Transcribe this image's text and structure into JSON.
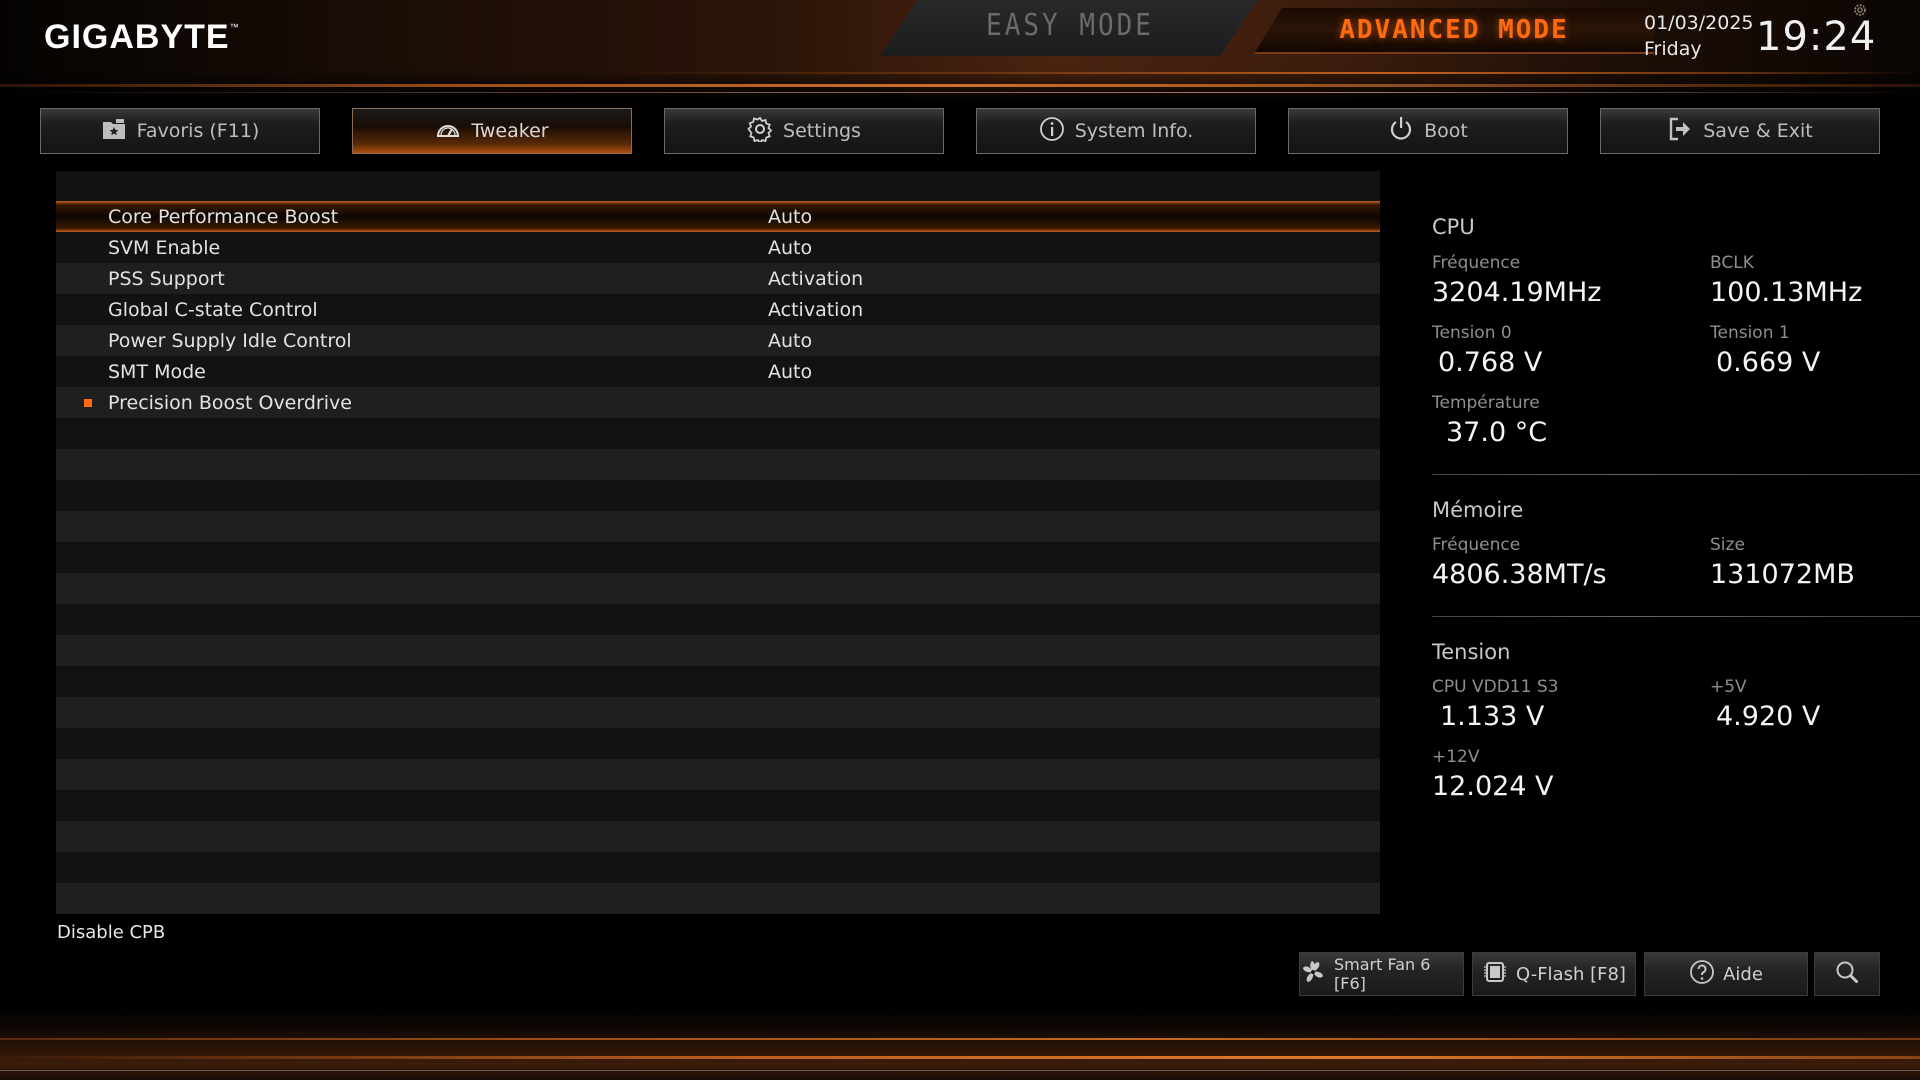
{
  "brand": {
    "logo": "GIGABYTE",
    "trademark": "™"
  },
  "modes": {
    "easy": "EASY MODE",
    "advanced": "ADVANCED MODE",
    "active": "advanced"
  },
  "datetime": {
    "date": "01/03/2025",
    "weekday": "Friday",
    "time": "19:24"
  },
  "tabs": [
    {
      "label": "Favoris (F11)",
      "icon": "favorites-folder-star-icon",
      "active": false
    },
    {
      "label": "Tweaker",
      "icon": "speedometer-icon",
      "active": true
    },
    {
      "label": "Settings",
      "icon": "gear-icon",
      "active": false
    },
    {
      "label": "System Info.",
      "icon": "info-icon",
      "active": false
    },
    {
      "label": "Boot",
      "icon": "power-icon",
      "active": false
    },
    {
      "label": "Save & Exit",
      "icon": "exit-icon",
      "active": false
    }
  ],
  "settings": [
    {
      "label": "Core Performance Boost",
      "value": "Auto",
      "selected": true,
      "submenu": false
    },
    {
      "label": "SVM Enable",
      "value": "Auto",
      "selected": false,
      "submenu": false
    },
    {
      "label": "PSS Support",
      "value": "Activation",
      "selected": false,
      "submenu": false
    },
    {
      "label": "Global C-state Control",
      "value": "Activation",
      "selected": false,
      "submenu": false
    },
    {
      "label": "Power Supply Idle Control",
      "value": "Auto",
      "selected": false,
      "submenu": false
    },
    {
      "label": "SMT Mode",
      "value": "Auto",
      "selected": false,
      "submenu": false
    },
    {
      "label": "Precision Boost Overdrive",
      "value": "",
      "selected": false,
      "submenu": true
    }
  ],
  "help_text": "Disable CPB",
  "info": {
    "cpu": {
      "title": "CPU",
      "freq_label": "Fréquence",
      "freq_value": "3204.19MHz",
      "bclk_label": "BCLK",
      "bclk_value": "100.13MHz",
      "v0_label": "Tension 0",
      "v0_value": "0.768 V",
      "v1_label": "Tension 1",
      "v1_value": "0.669 V",
      "temp_label": "Température",
      "temp_value": "37.0 °C"
    },
    "memory": {
      "title": "Mémoire",
      "freq_label": "Fréquence",
      "freq_value": "4806.38MT/s",
      "size_label": "Size",
      "size_value": "131072MB"
    },
    "voltage": {
      "title": "Tension",
      "vdd_label": "CPU VDD11 S3",
      "vdd_value": "1.133 V",
      "v5_label": "+5V",
      "v5_value": "4.920 V",
      "v12_label": "+12V",
      "v12_value": "12.024 V"
    }
  },
  "bottom_buttons": {
    "smartfan": "Smart Fan 6 [F6]",
    "qflash": "Q-Flash [F8]",
    "help": "Aide"
  },
  "colors": {
    "accent": "#ff6a10",
    "panel_row_dark": "#121212",
    "panel_row_light": "#1f1f1f"
  }
}
